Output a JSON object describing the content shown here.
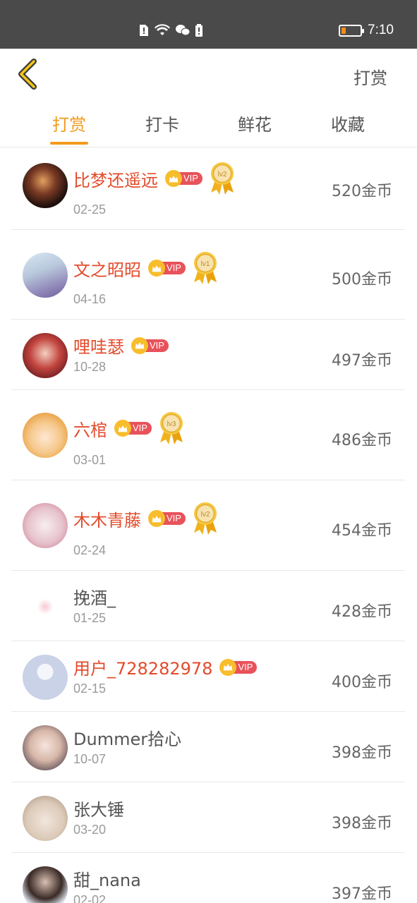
{
  "status_bar": {
    "time": "7:10",
    "battery_color": "#f28c1a",
    "battery_level": 0.25
  },
  "header": {
    "action_label": "打赏"
  },
  "tabs": [
    {
      "label": "打赏",
      "active": true
    },
    {
      "label": "打卡",
      "active": false
    },
    {
      "label": "鲜花",
      "active": false
    },
    {
      "label": "收藏",
      "active": false
    }
  ],
  "vip_label": "VIP",
  "records": [
    {
      "name": "比梦还遥远",
      "vip": true,
      "medal": "lv2",
      "date": "02-25",
      "amount": "520金币"
    },
    {
      "name": "文之昭昭",
      "vip": true,
      "medal": "lv1",
      "date": "04-16",
      "amount": "500金币"
    },
    {
      "name": "哩哇瑟",
      "vip": true,
      "medal": "",
      "date": "10-28",
      "amount": "497金币"
    },
    {
      "name": "六棺",
      "vip": true,
      "medal": "lv3",
      "date": "03-01",
      "amount": "486金币"
    },
    {
      "name": "木木青藤",
      "vip": true,
      "medal": "lv2",
      "date": "02-24",
      "amount": "454金币"
    },
    {
      "name": "挽酒_",
      "vip": false,
      "medal": "",
      "date": "01-25",
      "amount": "428金币"
    },
    {
      "name": "用户_728282978",
      "vip": true,
      "medal": "",
      "date": "02-15",
      "amount": "400金币"
    },
    {
      "name": "Dummer拾心",
      "vip": false,
      "medal": "",
      "date": "10-07",
      "amount": "398金币"
    },
    {
      "name": "张大锤",
      "vip": false,
      "medal": "",
      "date": "03-20",
      "amount": "398金币"
    },
    {
      "name": "甜_nana",
      "vip": false,
      "medal": "",
      "date": "02-02",
      "amount": "397金币"
    }
  ],
  "colors": {
    "accent": "#f29b1c",
    "vip_name": "#e34b2c",
    "vip_pill": "#e8525a",
    "crown": "#f8bd2c"
  }
}
